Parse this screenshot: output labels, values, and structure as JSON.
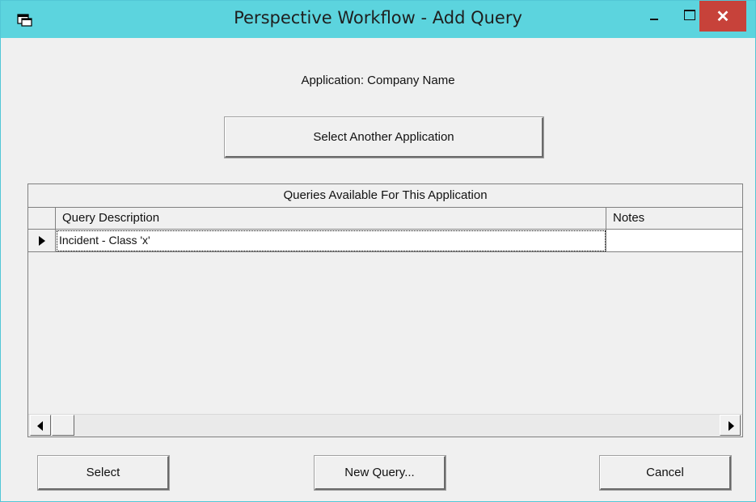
{
  "window": {
    "title": "Perspective Workflow - Add Query",
    "icon": "app-window-icon",
    "controls": {
      "minimize_icon": "minimize-icon",
      "maximize_icon": "maximize-icon",
      "close_label": "✕"
    }
  },
  "application": {
    "label": "Application:  Company Name"
  },
  "buttons": {
    "select_another": "Select Another Application",
    "select": "Select",
    "new_query": "New Query...",
    "cancel": "Cancel"
  },
  "grid": {
    "caption": "Queries Available For This Application",
    "columns": [
      "Query Description",
      "Notes"
    ],
    "rows": [
      {
        "description": "Incident - Class 'x'",
        "notes": ""
      }
    ]
  },
  "colors": {
    "titlebar": "#5cd4de",
    "close_button": "#c7423a",
    "window_bg": "#f0f0f0"
  }
}
